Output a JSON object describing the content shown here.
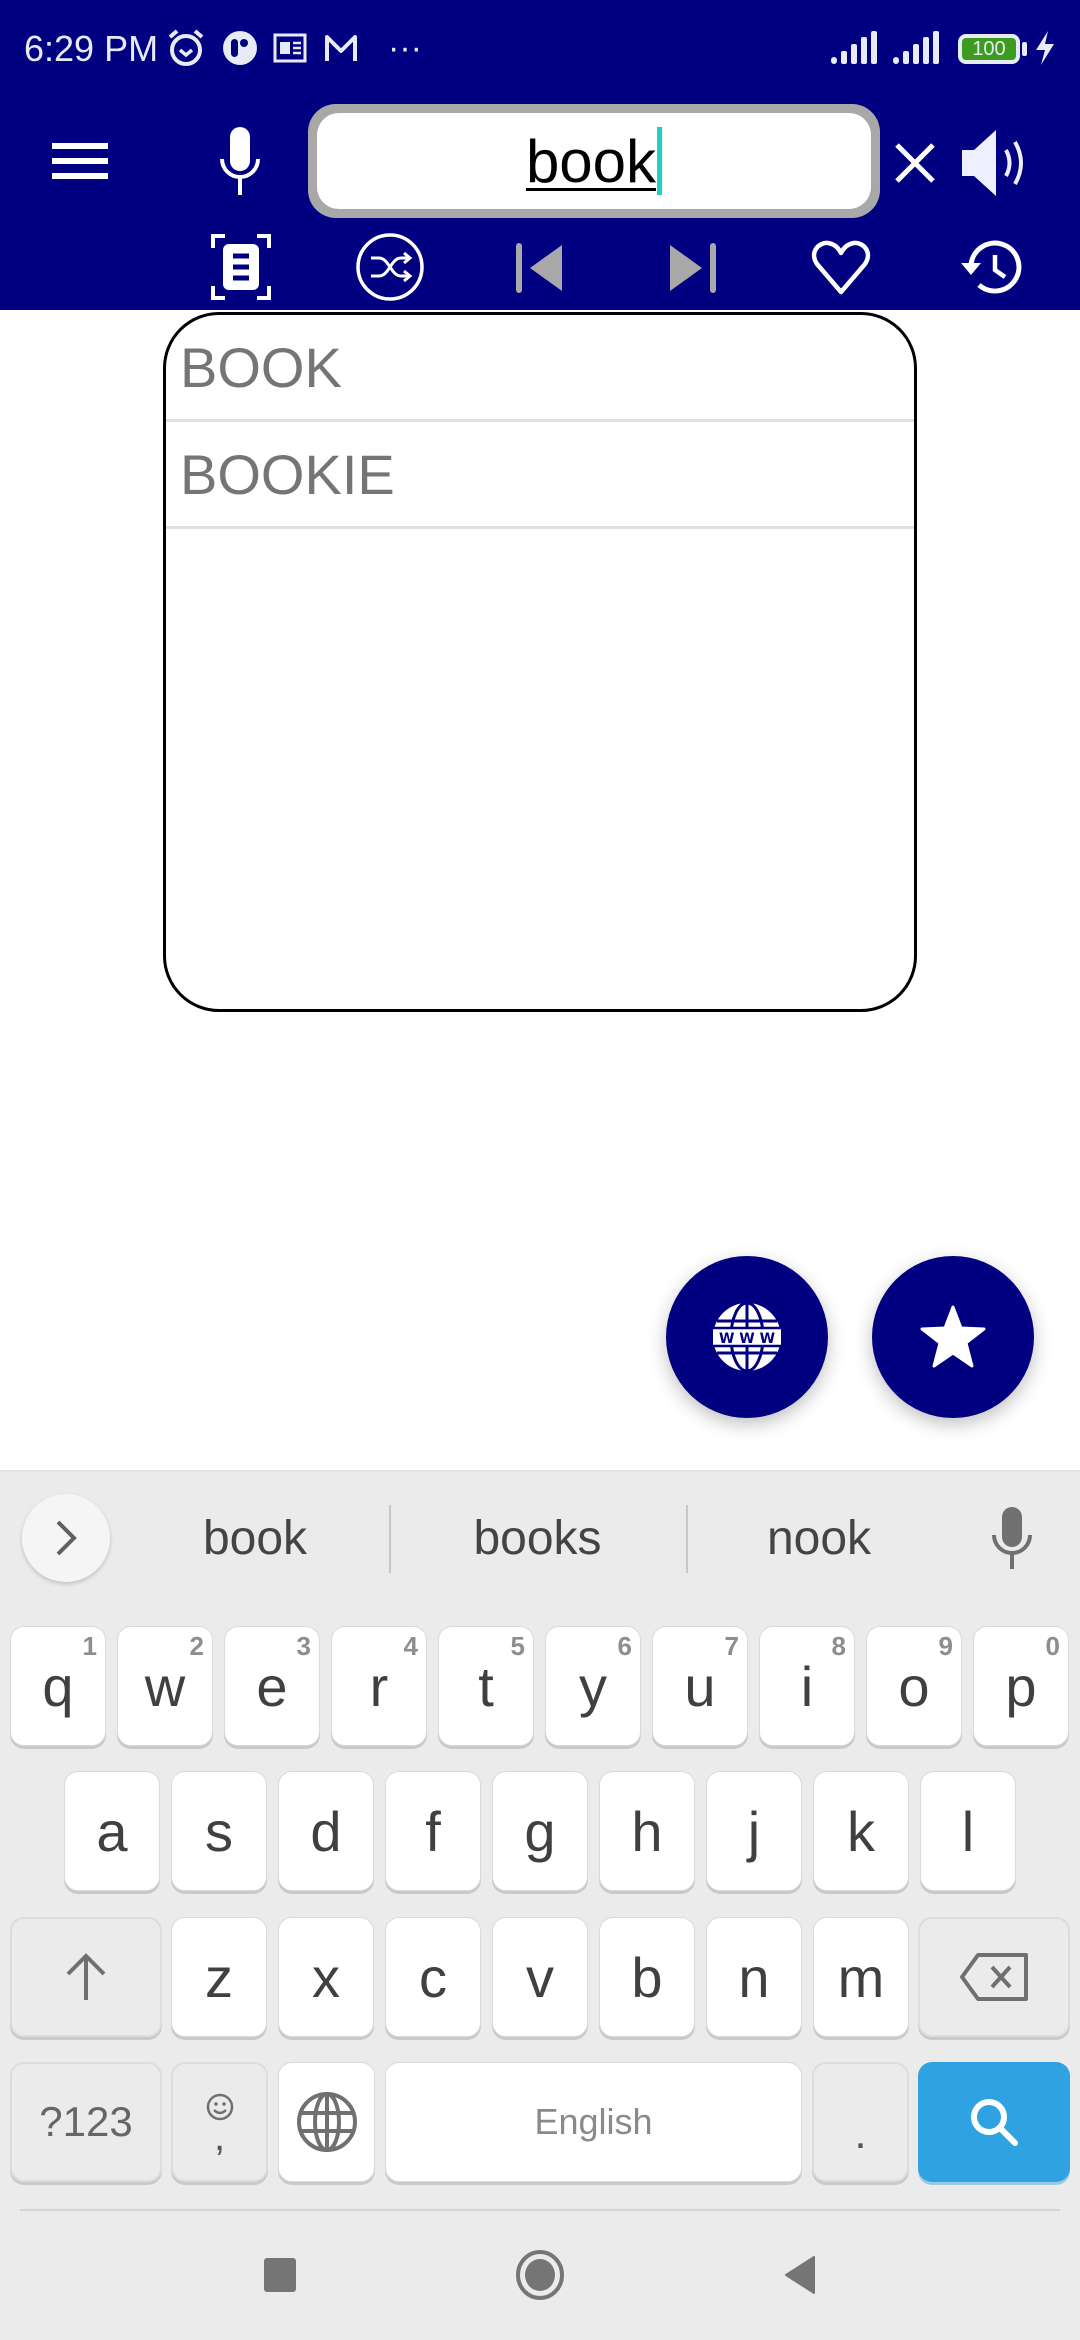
{
  "status_bar": {
    "time": "6:29 PM",
    "notification_icons": [
      "alarm-icon",
      "app-notification-icon",
      "news-icon",
      "gmail-icon",
      "more-icon"
    ],
    "more_label": "···",
    "battery_level": "100",
    "charging": true
  },
  "toolbar": {
    "menu_icon": "menu-icon",
    "voice_icon": "microphone-icon",
    "search_value": "book",
    "clear_icon": "close-icon",
    "speak_icon": "speaker-icon",
    "actions": [
      "scan-text-icon",
      "shuffle-icon",
      "previous-icon",
      "next-icon",
      "favorite-icon",
      "history-icon"
    ]
  },
  "suggestions_dropdown": {
    "items": [
      {
        "label": "BOOK"
      },
      {
        "label": "BOOKIE"
      }
    ]
  },
  "fabs": {
    "web_icon": "www-globe-icon",
    "star_icon": "star-icon"
  },
  "keyboard": {
    "suggestions": [
      "book",
      "books",
      "nook"
    ],
    "row1": [
      {
        "k": "q",
        "h": "1"
      },
      {
        "k": "w",
        "h": "2"
      },
      {
        "k": "e",
        "h": "3"
      },
      {
        "k": "r",
        "h": "4"
      },
      {
        "k": "t",
        "h": "5"
      },
      {
        "k": "y",
        "h": "6"
      },
      {
        "k": "u",
        "h": "7"
      },
      {
        "k": "i",
        "h": "8"
      },
      {
        "k": "o",
        "h": "9"
      },
      {
        "k": "p",
        "h": "0"
      }
    ],
    "row2": [
      "a",
      "s",
      "d",
      "f",
      "g",
      "h",
      "j",
      "k",
      "l"
    ],
    "row3": [
      "z",
      "x",
      "c",
      "v",
      "b",
      "n",
      "m"
    ],
    "symbols_label": "?123",
    "comma_label": ",",
    "space_label": "English",
    "period_label": ".",
    "colors": {
      "action_key": "#2fa3e1",
      "header": "#000080"
    }
  },
  "nav_bar": {
    "buttons": [
      "recents",
      "home",
      "back"
    ]
  }
}
